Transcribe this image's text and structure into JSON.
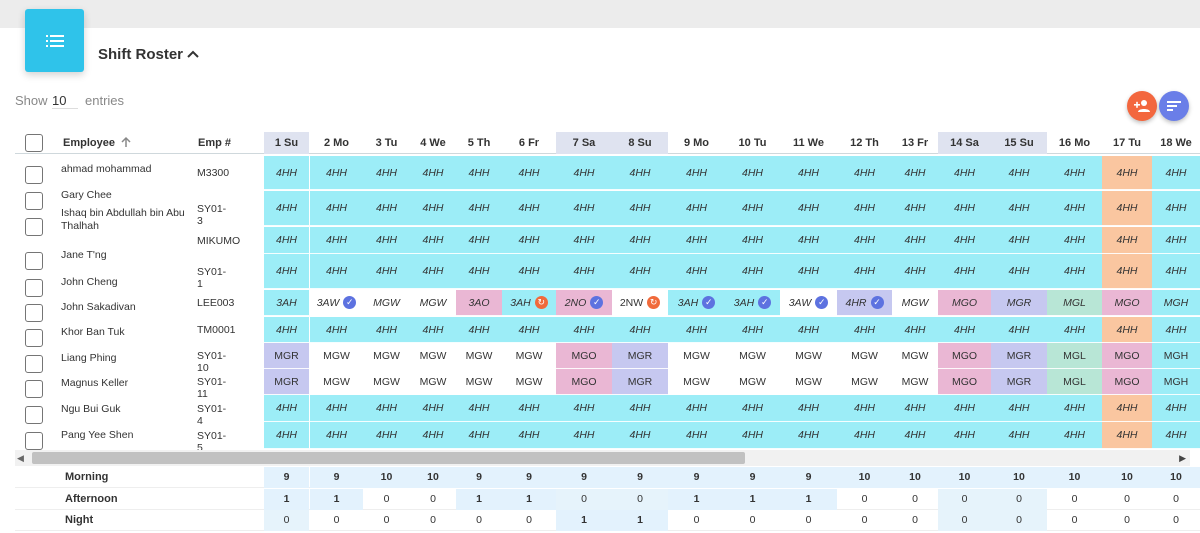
{
  "page": {
    "title": "Shift Roster",
    "show_label": "Show",
    "show_value": "10",
    "entries_label": "entries"
  },
  "icons": {
    "menu": "list-icon",
    "collapse": "chevron-up-icon",
    "add": "add-person-icon",
    "filter": "sort-icon",
    "approved": "check-circle-icon",
    "pending": "refresh-icon"
  },
  "colors": {
    "header_icon": "#2fc3ea",
    "add_button": "#f3673e",
    "filter_button": "#6a7ee8",
    "shift": {
      "HH": "#9cedf7",
      "HH_17": "#fac6a0",
      "GO": "#eab7d4",
      "GR": "#c6c8f0",
      "GL": "#b8e6d6",
      "HR": "#c6c8f0",
      "AO": "#eab7d4",
      "NO": "#eab7d4",
      "white": "#ffffff"
    },
    "weekend_header": "#dfe3f0",
    "summary_highlight": "#e3f2fd",
    "summary_weekend": "#e6f3fb"
  },
  "table": {
    "headers": {
      "employee": "Employee",
      "emp_no": "Emp #"
    },
    "days": [
      "1 Su",
      "2 Mo",
      "3 Tu",
      "4 We",
      "5 Th",
      "6 Fr",
      "7 Sa",
      "8 Su",
      "9 Mo",
      "10 Tu",
      "11 We",
      "12 Th",
      "13 Fr",
      "14 Sa",
      "15 Su",
      "16 Mo",
      "17 Tu",
      "18 We"
    ],
    "weekend_days": [
      0,
      6,
      7,
      13,
      14
    ],
    "rows": [
      {
        "name": "ahmad mohammad",
        "emp": "M3300",
        "cells": [
          "4HH",
          "4HH",
          "4HH",
          "4HH",
          "4HH",
          "4HH",
          "4HH",
          "4HH",
          "4HH",
          "4HH",
          "4HH",
          "4HH",
          "4HH",
          "4HH",
          "4HH",
          "4HH",
          "4HH",
          "4HH"
        ]
      },
      {
        "name": "Gary Chee",
        "emp": "SY01-3",
        "cells": [
          "4HH",
          "4HH",
          "4HH",
          "4HH",
          "4HH",
          "4HH",
          "4HH",
          "4HH",
          "4HH",
          "4HH",
          "4HH",
          "4HH",
          "4HH",
          "4HH",
          "4HH",
          "4HH",
          "4HH",
          "4HH"
        ]
      },
      {
        "name": "Ishaq bin Abdullah bin Abu Thalhah",
        "emp": "MIKUMO",
        "cells": [
          "4HH",
          "4HH",
          "4HH",
          "4HH",
          "4HH",
          "4HH",
          "4HH",
          "4HH",
          "4HH",
          "4HH",
          "4HH",
          "4HH",
          "4HH",
          "4HH",
          "4HH",
          "4HH",
          "4HH",
          "4HH"
        ]
      },
      {
        "name": "Jane T'ng",
        "emp": "SY01-1",
        "cells": [
          "4HH",
          "4HH",
          "4HH",
          "4HH",
          "4HH",
          "4HH",
          "4HH",
          "4HH",
          "4HH",
          "4HH",
          "4HH",
          "4HH",
          "4HH",
          "4HH",
          "4HH",
          "4HH",
          "4HH",
          "4HH"
        ]
      },
      {
        "name": "John Cheng",
        "emp": "LEE003",
        "cells": [
          "3AH",
          "3AW",
          "MGW",
          "MGW",
          "3AO",
          "3AH",
          "2NO",
          "2NW",
          "3AH",
          "3AH",
          "3AW",
          "4HR",
          "MGW",
          "MGO",
          "MGR",
          "MGL",
          "MGO",
          "MGH"
        ]
      },
      {
        "name": "John Sakadivan",
        "emp": "TM0001",
        "cells": [
          "4HH",
          "4HH",
          "4HH",
          "4HH",
          "4HH",
          "4HH",
          "4HH",
          "4HH",
          "4HH",
          "4HH",
          "4HH",
          "4HH",
          "4HH",
          "4HH",
          "4HH",
          "4HH",
          "4HH",
          "4HH"
        ]
      },
      {
        "name": "Khor Ban Tuk",
        "emp": "SY01-10",
        "cells": [
          "MGR",
          "MGW",
          "MGW",
          "MGW",
          "MGW",
          "MGW",
          "MGO",
          "MGR",
          "MGW",
          "MGW",
          "MGW",
          "MGW",
          "MGW",
          "MGO",
          "MGR",
          "MGL",
          "MGO",
          "MGH"
        ]
      },
      {
        "name": "Liang Phing",
        "emp": "SY01-11",
        "cells": [
          "MGR",
          "MGW",
          "MGW",
          "MGW",
          "MGW",
          "MGW",
          "MGO",
          "MGR",
          "MGW",
          "MGW",
          "MGW",
          "MGW",
          "MGW",
          "MGO",
          "MGR",
          "MGL",
          "MGO",
          "MGH"
        ]
      },
      {
        "name": "Magnus Keller",
        "emp": "SY01-4",
        "cells": [
          "4HH",
          "4HH",
          "4HH",
          "4HH",
          "4HH",
          "4HH",
          "4HH",
          "4HH",
          "4HH",
          "4HH",
          "4HH",
          "4HH",
          "4HH",
          "4HH",
          "4HH",
          "4HH",
          "4HH",
          "4HH"
        ]
      },
      {
        "name": "Ngu Bui Guk",
        "emp": "SY01-5",
        "cells": [
          "4HH",
          "4HH",
          "4HH",
          "4HH",
          "4HH",
          "4HH",
          "4HH",
          "4HH",
          "4HH",
          "4HH",
          "4HH",
          "4HH",
          "4HH",
          "4HH",
          "4HH",
          "4HH",
          "4HH",
          "4HH"
        ]
      },
      {
        "name": "Pang Yee Shen",
        "emp": "",
        "cells": []
      }
    ],
    "status_marks": [
      {
        "row": 4,
        "col": 1,
        "status": "approved"
      },
      {
        "row": 4,
        "col": 5,
        "status": "pending"
      },
      {
        "row": 4,
        "col": 6,
        "status": "approved"
      },
      {
        "row": 4,
        "col": 7,
        "status": "pending"
      },
      {
        "row": 4,
        "col": 8,
        "status": "approved"
      },
      {
        "row": 4,
        "col": 9,
        "status": "approved"
      },
      {
        "row": 4,
        "col": 10,
        "status": "approved"
      },
      {
        "row": 4,
        "col": 11,
        "status": "approved"
      }
    ]
  },
  "summary": {
    "rows": [
      {
        "label": "Morning",
        "values": [
          "9",
          "9",
          "10",
          "10",
          "9",
          "9",
          "9",
          "9",
          "9",
          "9",
          "9",
          "10",
          "10",
          "10",
          "10",
          "10",
          "10",
          "10"
        ]
      },
      {
        "label": "Afternoon",
        "values": [
          "1",
          "1",
          "0",
          "0",
          "1",
          "1",
          "0",
          "0",
          "1",
          "1",
          "1",
          "0",
          "0",
          "0",
          "0",
          "0",
          "0",
          "0"
        ]
      },
      {
        "label": "Night",
        "values": [
          "0",
          "0",
          "0",
          "0",
          "0",
          "0",
          "1",
          "1",
          "0",
          "0",
          "0",
          "0",
          "0",
          "0",
          "0",
          "0",
          "0",
          "0"
        ]
      }
    ]
  }
}
